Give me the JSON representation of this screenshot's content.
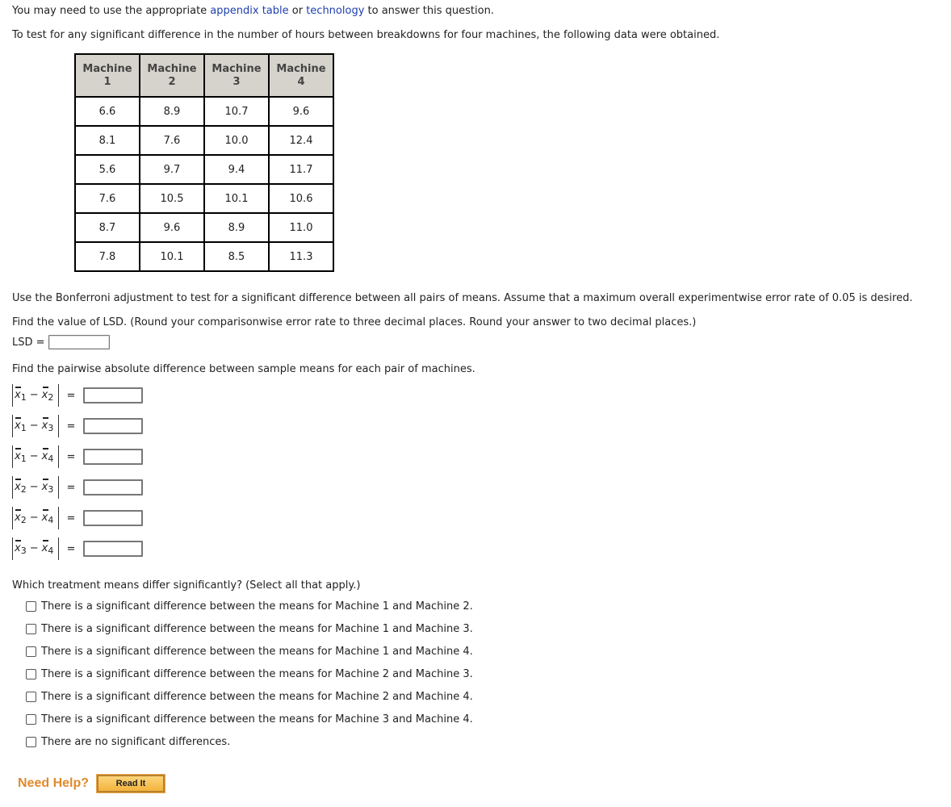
{
  "intro": {
    "prefix": "You may need to use the appropriate ",
    "link1": "appendix table",
    "middle": " or ",
    "link2": "technology",
    "suffix": " to answer this question."
  },
  "problem_statement": "To test for any significant difference in the number of hours between breakdowns for four machines, the following data were obtained.",
  "table": {
    "headers": [
      {
        "line1": "Machine",
        "line2": "1"
      },
      {
        "line1": "Machine",
        "line2": "2"
      },
      {
        "line1": "Machine",
        "line2": "3"
      },
      {
        "line1": "Machine",
        "line2": "4"
      }
    ],
    "rows": [
      [
        "6.6",
        "8.9",
        "10.7",
        "9.6"
      ],
      [
        "8.1",
        "7.6",
        "10.0",
        "12.4"
      ],
      [
        "5.6",
        "9.7",
        "9.4",
        "11.7"
      ],
      [
        "7.6",
        "10.5",
        "10.1",
        "10.6"
      ],
      [
        "8.7",
        "9.6",
        "8.9",
        "11.0"
      ],
      [
        "7.8",
        "10.1",
        "8.5",
        "11.3"
      ]
    ]
  },
  "bonferroni_text": "Use the Bonferroni adjustment to test for a significant difference between all pairs of means. Assume that a maximum overall experimentwise error rate of 0.05 is desired.",
  "lsd_instruction": "Find the value of LSD. (Round your comparisonwise error rate to three decimal places. Round your answer to two decimal places.)",
  "lsd_label": "LSD =",
  "lsd_value": "",
  "pairwise_instruction": "Find the pairwise absolute difference between sample means for each pair of machines.",
  "pairwise": [
    {
      "a": "1",
      "b": "2",
      "value": ""
    },
    {
      "a": "1",
      "b": "3",
      "value": ""
    },
    {
      "a": "1",
      "b": "4",
      "value": ""
    },
    {
      "a": "2",
      "b": "3",
      "value": ""
    },
    {
      "a": "2",
      "b": "4",
      "value": ""
    },
    {
      "a": "3",
      "b": "4",
      "value": ""
    }
  ],
  "symbols": {
    "x": "x",
    "minus": "−",
    "equals": "="
  },
  "question": "Which treatment means differ significantly? (Select all that apply.)",
  "options": [
    {
      "label": "There is a significant difference between the means for Machine 1 and Machine 2.",
      "checked": false
    },
    {
      "label": "There is a significant difference between the means for Machine 1 and Machine 3.",
      "checked": false
    },
    {
      "label": "There is a significant difference between the means for Machine 1 and Machine 4.",
      "checked": false
    },
    {
      "label": "There is a significant difference between the means for Machine 2 and Machine 3.",
      "checked": false
    },
    {
      "label": "There is a significant difference between the means for Machine 2 and Machine 4.",
      "checked": false
    },
    {
      "label": "There is a significant difference between the means for Machine 3 and Machine 4.",
      "checked": false
    },
    {
      "label": "There are no significant differences.",
      "checked": false
    }
  ],
  "help": {
    "need_help": "Need Help?",
    "read_it": "Read It"
  },
  "colors": {
    "link": "#1f3fae",
    "table_header_bg": "#d6d3cc",
    "need_help": "#e08a2c",
    "button_fill": "#f3b33c"
  }
}
